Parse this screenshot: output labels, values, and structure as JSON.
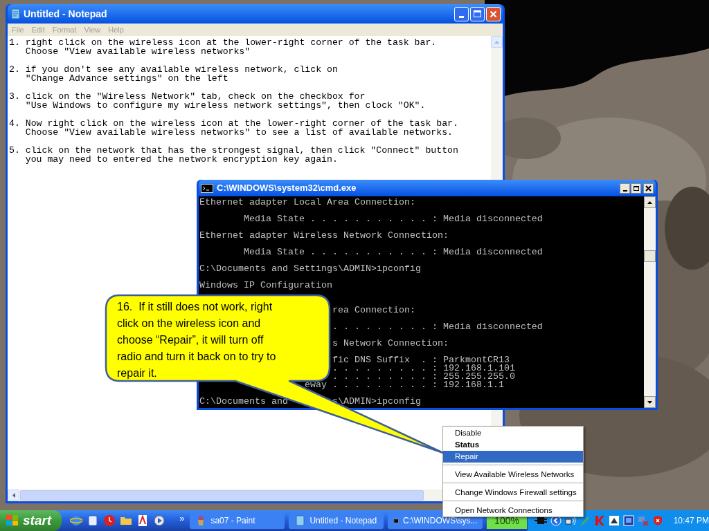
{
  "notepad": {
    "title": "Untitled - Notepad",
    "menu": [
      {
        "label": "File",
        "disabled": true
      },
      {
        "label": "Edit",
        "disabled": true
      },
      {
        "label": "Format",
        "disabled": true
      },
      {
        "label": "View",
        "disabled": true
      },
      {
        "label": "Help",
        "disabled": true
      }
    ],
    "steps": [
      {
        "number": "1.",
        "lines": [
          "right click on the wireless icon at the lower-right corner of the task bar.",
          "Choose \"View available wireless networks\""
        ]
      },
      {
        "number": "2.",
        "lines": [
          "if you don't see any available wireless network, click on",
          "\"Change Advance settings\" on the left"
        ]
      },
      {
        "number": "3.",
        "lines": [
          "click on the \"Wireless Network\" tab, check on the checkbox for",
          "\"Use Windows to configure my wireless network settings\", then clock \"OK\"."
        ]
      },
      {
        "number": "4.",
        "lines": [
          "Now right click on the wireless icon at the lower-right corner of the task bar.",
          "Choose \"View available wireless networks\" to see a list of available networks."
        ]
      },
      {
        "number": "5.",
        "lines": [
          "click on the network that has the strongest signal, then click \"Connect\" button",
          "you may need to entered the network encryption key again."
        ]
      }
    ]
  },
  "cmd": {
    "title": "C:\\WINDOWS\\system32\\cmd.exe",
    "lines": [
      {
        "kind": "text",
        "text": "Ethernet adapter Local Area Connection:"
      },
      {
        "kind": "blank"
      },
      {
        "kind": "field",
        "label": "Media State . . . . . . . . . . .",
        "value": ": Media disconnected"
      },
      {
        "kind": "blank"
      },
      {
        "kind": "text",
        "text": "Ethernet adapter Wireless Network Connection:"
      },
      {
        "kind": "blank"
      },
      {
        "kind": "field",
        "label": "Media State . . . . . . . . . . .",
        "value": ": Media disconnected"
      },
      {
        "kind": "blank"
      },
      {
        "kind": "text",
        "text": "C:\\Documents and Settings\\ADMIN>ipconfig"
      },
      {
        "kind": "blank"
      },
      {
        "kind": "text",
        "text": "Windows IP Configuration"
      },
      {
        "kind": "blank"
      },
      {
        "kind": "blank"
      },
      {
        "kind": "clipped",
        "text": "rea Connection:"
      },
      {
        "kind": "blank"
      },
      {
        "kind": "field",
        "label": ". . . . . . . . .",
        "value": ": Media disconnected"
      },
      {
        "kind": "blank"
      },
      {
        "kind": "clipped",
        "text": "s Network Connection:"
      },
      {
        "kind": "blank"
      },
      {
        "kind": "field",
        "label": "fic DNS Suffix  .",
        "value": ": ParkmontCR13"
      },
      {
        "kind": "field",
        "label": ". . . . . . . . .",
        "value": ": 192.168.1.101"
      },
      {
        "kind": "field",
        "label": ". . . . . . . . .",
        "value": ": 255.255.255.0"
      },
      {
        "kind": "field",
        "label": "eway . . . . . . . . .",
        "value": ": 192.168.1.1"
      },
      {
        "kind": "blank"
      },
      {
        "kind": "split",
        "left": "C:\\Documents and",
        "right": "s\\ADMIN>ipconfig"
      }
    ]
  },
  "callout": {
    "text": "16.  If it still does not work, right click on the wireless icon and choose “Repair”, it will turn off radio and turn it back on to try to repair it."
  },
  "context_menu": [
    {
      "label": "Disable",
      "default": false,
      "selected": false,
      "separator_before": false
    },
    {
      "label": "Status",
      "default": true,
      "selected": false,
      "separator_before": false
    },
    {
      "label": "Repair",
      "default": false,
      "selected": true,
      "separator_before": false
    },
    {
      "label": "View Available Wireless Networks",
      "default": false,
      "selected": false,
      "separator_before": true
    },
    {
      "label": "Change Windows Firewall settings",
      "default": false,
      "selected": false,
      "separator_before": true
    },
    {
      "label": "Open Network Connections",
      "default": false,
      "selected": false,
      "separator_before": true
    }
  ],
  "taskbar": {
    "start": "start",
    "overflow": "»",
    "tasks": [
      {
        "kind": "paint",
        "label": "sa07 - Paint",
        "selected": false
      },
      {
        "kind": "notepad",
        "label": "Untitled - Notepad",
        "selected": false
      },
      {
        "kind": "cmd",
        "label": "C:\\WINDOWS\\sys...",
        "selected": false
      }
    ],
    "battery": "100%",
    "clock": "10:47 PM"
  }
}
